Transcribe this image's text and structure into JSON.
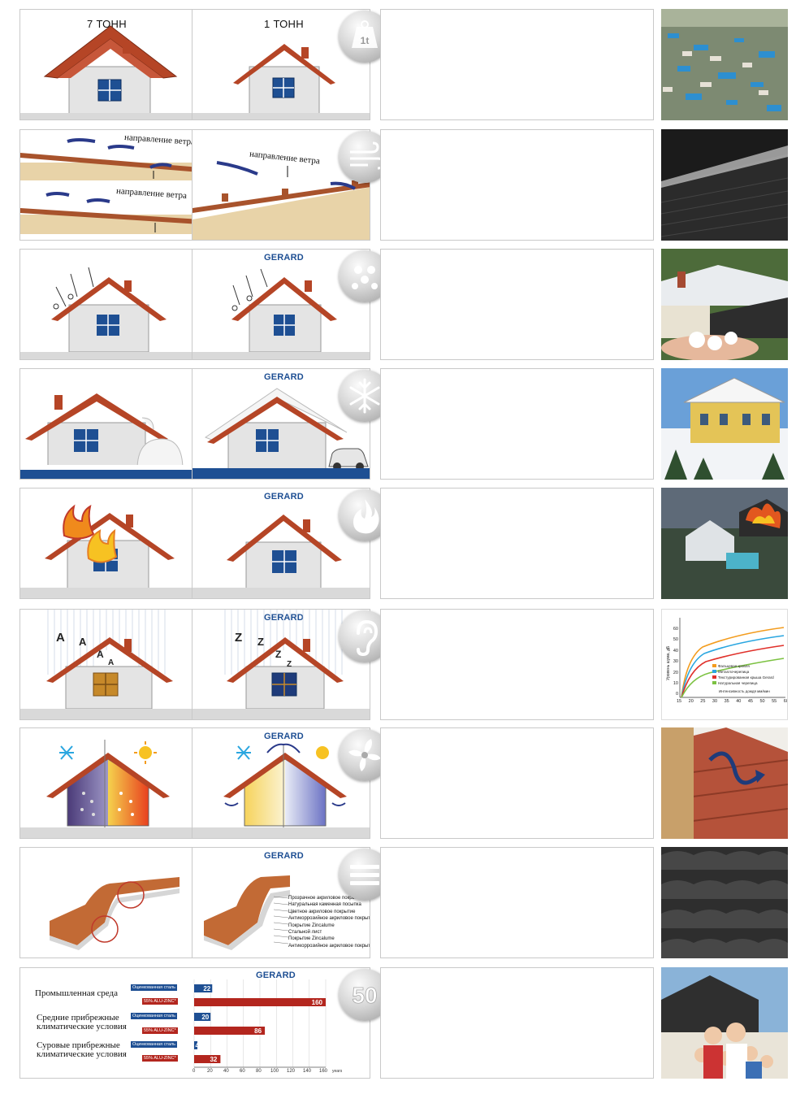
{
  "row_weight": {
    "left_label": "7 ТОНН",
    "mid_label": "1 ТОНН",
    "badge_icon": "weight-1t-icon",
    "badge_text": "1t"
  },
  "row_wind": {
    "label_top_left": "направление ветра",
    "label_bottom_left": "направление ветра",
    "label_mid": "направление ветра",
    "badge_icon": "wind-icon"
  },
  "row_hail": {
    "brand": "GERARD",
    "badge_icon": "hail-icon"
  },
  "row_snow": {
    "brand": "GERARD",
    "badge_icon": "snowflake-icon"
  },
  "row_fire": {
    "brand": "GERARD",
    "badge_icon": "flame-icon"
  },
  "row_noise": {
    "brand": "GERARD",
    "badge_icon": "ear-icon",
    "letters_left": [
      "A",
      "A",
      "A",
      "A"
    ],
    "letters_mid": [
      "Z",
      "Z",
      "Z",
      "Z"
    ],
    "chart": {
      "yticks": [
        "60",
        "50",
        "40",
        "30",
        "20",
        "10",
        "0"
      ],
      "xticks": [
        "15",
        "20",
        "25",
        "30",
        "35",
        "40",
        "45",
        "50",
        "55",
        "60"
      ],
      "ylabel": "Уровень шума, дБ",
      "xlabel": "Интенсивность дождя мм/мин",
      "legend": [
        "Фальцевая кровля",
        "Металлочерепица",
        "Текстурированная крыша Gerard",
        "Натуральная черепица"
      ],
      "colors": [
        "#f39c1e",
        "#2aa6e0",
        "#e0302a",
        "#7cc242"
      ]
    }
  },
  "row_vent": {
    "brand": "GERARD",
    "badge_icon": "fan-icon"
  },
  "row_layers": {
    "brand": "GERARD",
    "badge_icon": "layers-icon",
    "layers": [
      "Прозрачное акриловое покрытие",
      "Натуральная каменная посыпка",
      "Цветное акриловое покрытие",
      "Антикоррозийное акриловое покрытие",
      "Покрытие Zincalume",
      "Стальной лист",
      "Покрытие Zincalume",
      "Антикоррозийное акриловое покрытие"
    ]
  },
  "row_durability": {
    "brand": "GERARD",
    "badge_text": "50",
    "chart_data": {
      "type": "bar",
      "categories": [
        "Промышленная среда",
        "Средние прибрежные климатические условия",
        "Суровые прибрежные климатические условия"
      ],
      "category_lines": [
        [
          "Промышленная среда"
        ],
        [
          "Средние прибрежные",
          "климатические условия"
        ],
        [
          "Суровые прибрежные",
          "климатические условия"
        ]
      ],
      "series": [
        {
          "name": "Оцинкованная сталь",
          "values": [
            22,
            20,
            4
          ],
          "color": "#1e4f93"
        },
        {
          "name": "55% ALU-ZINC*",
          "values": [
            160,
            86,
            32
          ],
          "color": "#b3261e"
        }
      ],
      "xticks": [
        "0",
        "20",
        "40",
        "60",
        "80",
        "100",
        "120",
        "140",
        "160"
      ],
      "xunit": "years",
      "xlim": [
        0,
        160
      ]
    }
  }
}
